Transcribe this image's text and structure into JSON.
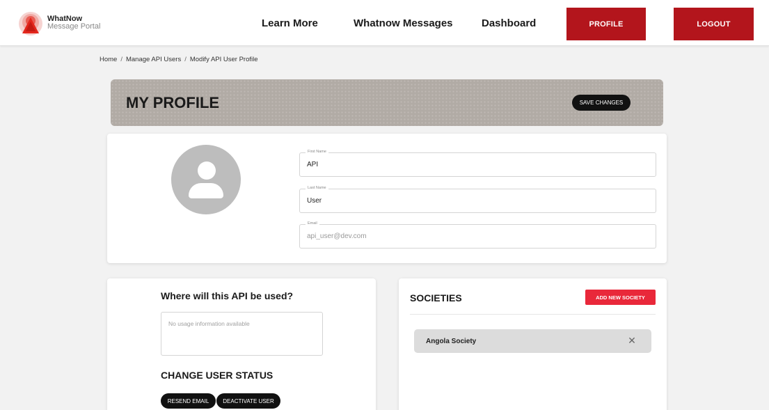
{
  "header": {
    "brand_name": "WhatNow",
    "brand_sub": "Message Portal",
    "nav": {
      "learn_more": "Learn More",
      "whatnow_messages": "Whatnow Messages",
      "dashboard": "Dashboard"
    },
    "profile_label": "PROFILE",
    "logout_label": "LOGOUT",
    "accent_color": "#b3151c"
  },
  "breadcrumb": {
    "items": [
      "Home",
      "Manage API Users",
      "Modify API User Profile"
    ],
    "separator": "/"
  },
  "banner": {
    "title": "MY PROFILE",
    "save_label": "SAVE CHANGES"
  },
  "profile": {
    "avatar_icon": "user-avatar-icon",
    "first_name": {
      "label": "First Name",
      "value": "API"
    },
    "last_name": {
      "label": "Last Name",
      "value": "User"
    },
    "email": {
      "label": "Email",
      "placeholder": "api_user@dev.com"
    }
  },
  "usage": {
    "title": "Where will this API be used?",
    "placeholder": "No usage information available"
  },
  "status": {
    "title": "CHANGE USER STATUS",
    "resend_label": "RESEND EMAIL",
    "deactivate_label": "DEACTIVATE USER"
  },
  "societies": {
    "title": "SOCIETIES",
    "add_label": "ADD NEW SOCIETY",
    "add_color": "#e9283a",
    "items": [
      {
        "name": "Angola Society",
        "close_glyph": "✕"
      }
    ]
  }
}
